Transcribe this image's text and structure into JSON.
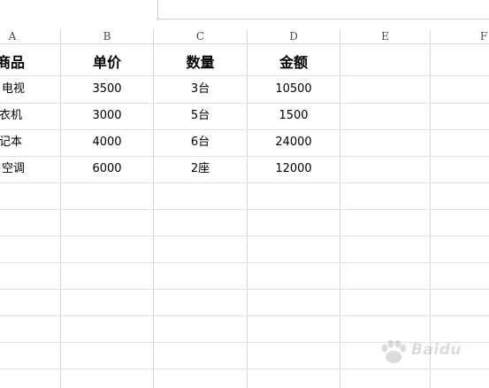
{
  "columns": [
    "A",
    "B",
    "C",
    "D",
    "E",
    "F"
  ],
  "table": {
    "headers": [
      "商品",
      "单价",
      "数量",
      "金额"
    ],
    "rows": [
      [
        "电视",
        "3500",
        "3台",
        "10500"
      ],
      [
        "洗衣机",
        "3000",
        "5台",
        "1500"
      ],
      [
        "笔记本",
        "4000",
        "6台",
        "24000"
      ],
      [
        "空调",
        "6000",
        "2座",
        "12000"
      ]
    ]
  },
  "watermark": {
    "text": "Baidu",
    "icon": "baidu-paw-icon"
  },
  "colors": {
    "grid": "#d8d8d8",
    "header_text": "#4a4a4a"
  }
}
